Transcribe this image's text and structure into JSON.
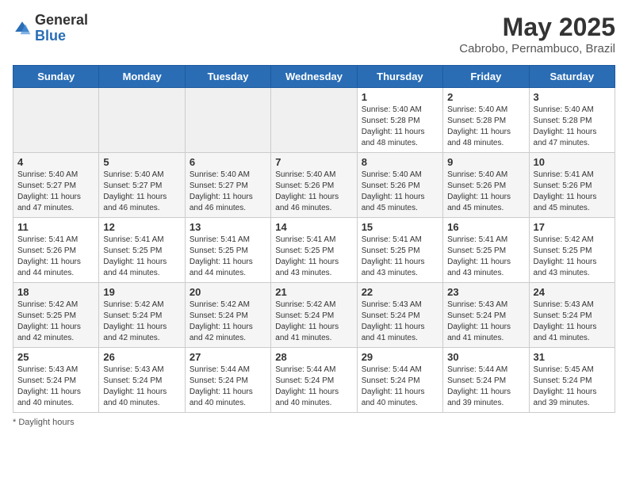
{
  "header": {
    "logo_general": "General",
    "logo_blue": "Blue",
    "month_year": "May 2025",
    "location": "Cabrobo, Pernambuco, Brazil"
  },
  "days_of_week": [
    "Sunday",
    "Monday",
    "Tuesday",
    "Wednesday",
    "Thursday",
    "Friday",
    "Saturday"
  ],
  "weeks": [
    [
      {
        "day": "",
        "detail": ""
      },
      {
        "day": "",
        "detail": ""
      },
      {
        "day": "",
        "detail": ""
      },
      {
        "day": "",
        "detail": ""
      },
      {
        "day": "1",
        "detail": "Sunrise: 5:40 AM\nSunset: 5:28 PM\nDaylight: 11 hours\nand 48 minutes."
      },
      {
        "day": "2",
        "detail": "Sunrise: 5:40 AM\nSunset: 5:28 PM\nDaylight: 11 hours\nand 48 minutes."
      },
      {
        "day": "3",
        "detail": "Sunrise: 5:40 AM\nSunset: 5:28 PM\nDaylight: 11 hours\nand 47 minutes."
      }
    ],
    [
      {
        "day": "4",
        "detail": "Sunrise: 5:40 AM\nSunset: 5:27 PM\nDaylight: 11 hours\nand 47 minutes."
      },
      {
        "day": "5",
        "detail": "Sunrise: 5:40 AM\nSunset: 5:27 PM\nDaylight: 11 hours\nand 46 minutes."
      },
      {
        "day": "6",
        "detail": "Sunrise: 5:40 AM\nSunset: 5:27 PM\nDaylight: 11 hours\nand 46 minutes."
      },
      {
        "day": "7",
        "detail": "Sunrise: 5:40 AM\nSunset: 5:26 PM\nDaylight: 11 hours\nand 46 minutes."
      },
      {
        "day": "8",
        "detail": "Sunrise: 5:40 AM\nSunset: 5:26 PM\nDaylight: 11 hours\nand 45 minutes."
      },
      {
        "day": "9",
        "detail": "Sunrise: 5:40 AM\nSunset: 5:26 PM\nDaylight: 11 hours\nand 45 minutes."
      },
      {
        "day": "10",
        "detail": "Sunrise: 5:41 AM\nSunset: 5:26 PM\nDaylight: 11 hours\nand 45 minutes."
      }
    ],
    [
      {
        "day": "11",
        "detail": "Sunrise: 5:41 AM\nSunset: 5:26 PM\nDaylight: 11 hours\nand 44 minutes."
      },
      {
        "day": "12",
        "detail": "Sunrise: 5:41 AM\nSunset: 5:25 PM\nDaylight: 11 hours\nand 44 minutes."
      },
      {
        "day": "13",
        "detail": "Sunrise: 5:41 AM\nSunset: 5:25 PM\nDaylight: 11 hours\nand 44 minutes."
      },
      {
        "day": "14",
        "detail": "Sunrise: 5:41 AM\nSunset: 5:25 PM\nDaylight: 11 hours\nand 43 minutes."
      },
      {
        "day": "15",
        "detail": "Sunrise: 5:41 AM\nSunset: 5:25 PM\nDaylight: 11 hours\nand 43 minutes."
      },
      {
        "day": "16",
        "detail": "Sunrise: 5:41 AM\nSunset: 5:25 PM\nDaylight: 11 hours\nand 43 minutes."
      },
      {
        "day": "17",
        "detail": "Sunrise: 5:42 AM\nSunset: 5:25 PM\nDaylight: 11 hours\nand 43 minutes."
      }
    ],
    [
      {
        "day": "18",
        "detail": "Sunrise: 5:42 AM\nSunset: 5:25 PM\nDaylight: 11 hours\nand 42 minutes."
      },
      {
        "day": "19",
        "detail": "Sunrise: 5:42 AM\nSunset: 5:24 PM\nDaylight: 11 hours\nand 42 minutes."
      },
      {
        "day": "20",
        "detail": "Sunrise: 5:42 AM\nSunset: 5:24 PM\nDaylight: 11 hours\nand 42 minutes."
      },
      {
        "day": "21",
        "detail": "Sunrise: 5:42 AM\nSunset: 5:24 PM\nDaylight: 11 hours\nand 41 minutes."
      },
      {
        "day": "22",
        "detail": "Sunrise: 5:43 AM\nSunset: 5:24 PM\nDaylight: 11 hours\nand 41 minutes."
      },
      {
        "day": "23",
        "detail": "Sunrise: 5:43 AM\nSunset: 5:24 PM\nDaylight: 11 hours\nand 41 minutes."
      },
      {
        "day": "24",
        "detail": "Sunrise: 5:43 AM\nSunset: 5:24 PM\nDaylight: 11 hours\nand 41 minutes."
      }
    ],
    [
      {
        "day": "25",
        "detail": "Sunrise: 5:43 AM\nSunset: 5:24 PM\nDaylight: 11 hours\nand 40 minutes."
      },
      {
        "day": "26",
        "detail": "Sunrise: 5:43 AM\nSunset: 5:24 PM\nDaylight: 11 hours\nand 40 minutes."
      },
      {
        "day": "27",
        "detail": "Sunrise: 5:44 AM\nSunset: 5:24 PM\nDaylight: 11 hours\nand 40 minutes."
      },
      {
        "day": "28",
        "detail": "Sunrise: 5:44 AM\nSunset: 5:24 PM\nDaylight: 11 hours\nand 40 minutes."
      },
      {
        "day": "29",
        "detail": "Sunrise: 5:44 AM\nSunset: 5:24 PM\nDaylight: 11 hours\nand 40 minutes."
      },
      {
        "day": "30",
        "detail": "Sunrise: 5:44 AM\nSunset: 5:24 PM\nDaylight: 11 hours\nand 39 minutes."
      },
      {
        "day": "31",
        "detail": "Sunrise: 5:45 AM\nSunset: 5:24 PM\nDaylight: 11 hours\nand 39 minutes."
      }
    ]
  ],
  "footer": {
    "note": "Daylight hours"
  }
}
